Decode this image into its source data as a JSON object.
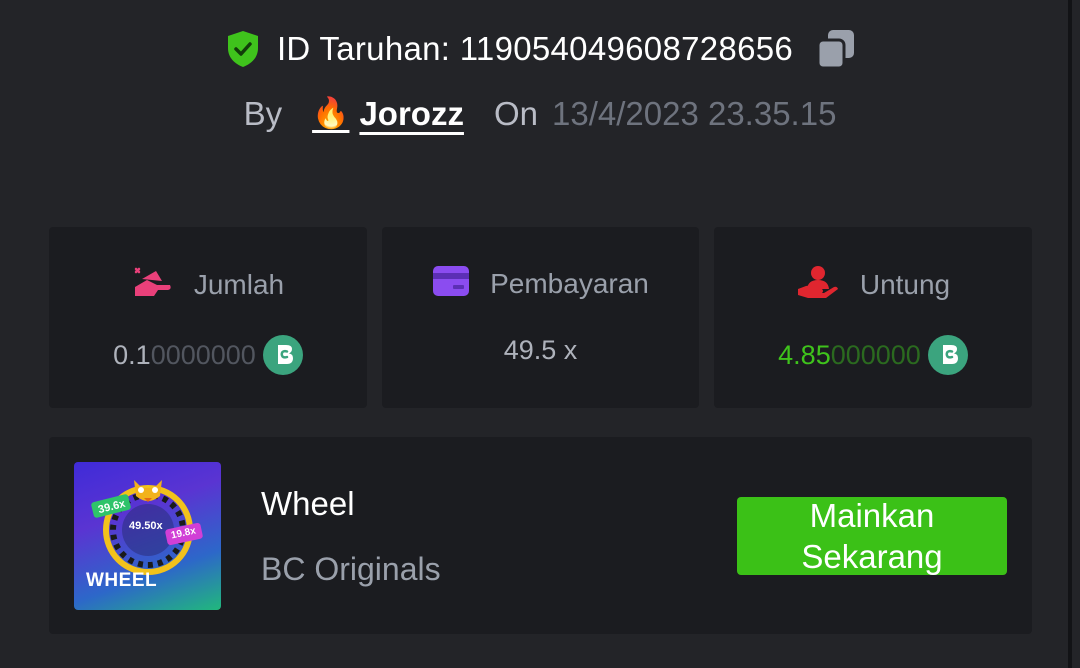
{
  "bet": {
    "id_text": "ID Taruhan: 119054049608728656",
    "by_label": "By",
    "username": "Jorozz",
    "on_label": "On",
    "datetime": "13/4/2023 23.35.15"
  },
  "stats": [
    {
      "title": "Jumlah",
      "value_main": "0.1",
      "value_dim": "0000000",
      "icon": "bet-amount-icon"
    },
    {
      "title": "Pembayaran",
      "value_main": "49.5 x",
      "icon": "payout-card-icon"
    },
    {
      "title": "Untung",
      "value_main": "4.85",
      "value_dim": "000000",
      "icon": "profit-hand-icon"
    }
  ],
  "game": {
    "name": "Wheel",
    "provider": "BC Originals",
    "thumb_title": "WHEEL",
    "thumb_labels": [
      "39.6x",
      "49.50x",
      "19.8x"
    ],
    "play_label": "Mainkan Sekarang"
  },
  "colors": {
    "background": "#232428",
    "card": "#1b1c20",
    "accent_green": "#3bc117",
    "profit_green": "#3fc31c",
    "coin": "#3ba47e",
    "pink": "#e9407a",
    "purple": "#8b4cf0",
    "red": "#e0262f"
  }
}
